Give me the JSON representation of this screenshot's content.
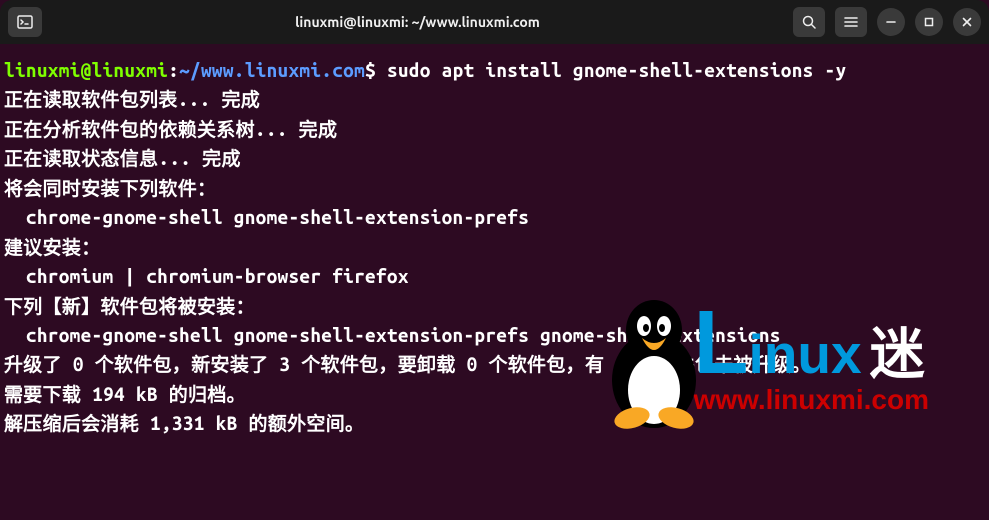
{
  "titlebar": {
    "title": "linuxmi@linuxmi: ~/www.linuxmi.com"
  },
  "prompt": {
    "user_host": "linuxmi@linuxmi",
    "colon": ":",
    "path": "~/www.linuxmi.com",
    "dollar": "$"
  },
  "command": "sudo apt install gnome-shell-extensions -y",
  "output_lines": [
    "正在读取软件包列表... 完成",
    "正在分析软件包的依赖关系树... 完成",
    "正在读取状态信息... 完成",
    "将会同时安装下列软件：",
    "  chrome-gnome-shell gnome-shell-extension-prefs",
    "建议安装：",
    "  chromium | chromium-browser firefox",
    "下列【新】软件包将被安装：",
    "  chrome-gnome-shell gnome-shell-extension-prefs gnome-shell-extensions",
    "升级了 0 个软件包，新安装了 3 个软件包，要卸载 0 个软件包，有 4 个软件包未被升级。",
    "需要下载 194 kB 的归档。",
    "解压缩后会消耗 1,331 kB 的额外空间。"
  ],
  "watermark": {
    "text_l": "L",
    "text_inux": "inux",
    "text_mi": "迷",
    "url": "www.linuxmi.com"
  }
}
